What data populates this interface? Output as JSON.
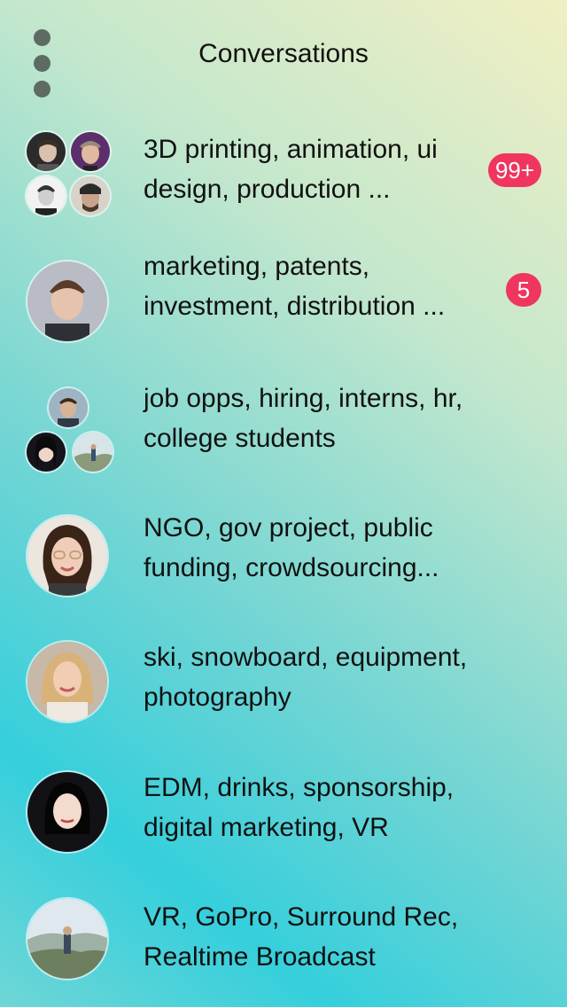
{
  "header": {
    "title": "Conversations"
  },
  "conversations": [
    {
      "topics": "3D printing, animation, ui design, production ...",
      "badge": "99+"
    },
    {
      "topics": "marketing, patents, investment, distribution ...",
      "badge": "5"
    },
    {
      "topics": "job opps, hiring, interns, hr, college students",
      "badge": ""
    },
    {
      "topics": "NGO, gov project, public funding, crowdsourcing...",
      "badge": ""
    },
    {
      "topics": "ski, snowboard, equipment, photography",
      "badge": ""
    },
    {
      "topics": "EDM, drinks, sponsorship, digital marketing, VR",
      "badge": ""
    },
    {
      "topics": "VR, GoPro, Surround Rec, Realtime Broadcast",
      "badge": ""
    }
  ],
  "colors": {
    "badge": "#f0355f",
    "menu_dots": "#5d6b63",
    "gradient_top": "#f1efc3",
    "gradient_bottom": "#35cfdc"
  },
  "icons": {
    "menu": "vertical-ellipsis-icon"
  }
}
